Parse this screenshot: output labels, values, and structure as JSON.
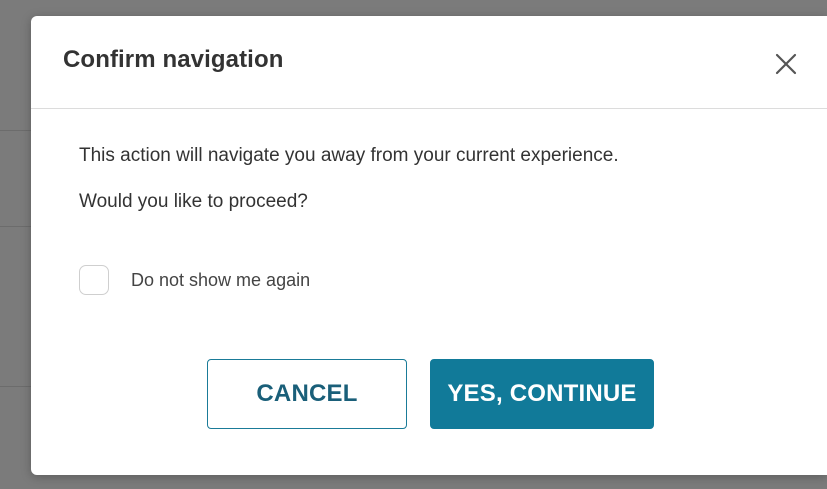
{
  "dialog": {
    "title": "Confirm navigation",
    "message_line1": "This action will navigate you away from your current experience.",
    "message_line2": "Would you like to proceed?",
    "checkbox_label": "Do not show me again",
    "checkbox_checked": false,
    "cancel_label": "CANCEL",
    "continue_label": "YES, CONTINUE",
    "close_icon": "close-icon"
  },
  "colors": {
    "primary": "#117a99",
    "primary_text": "#1a5f79",
    "title_text": "#333333",
    "backdrop": "#7b7b7b"
  }
}
